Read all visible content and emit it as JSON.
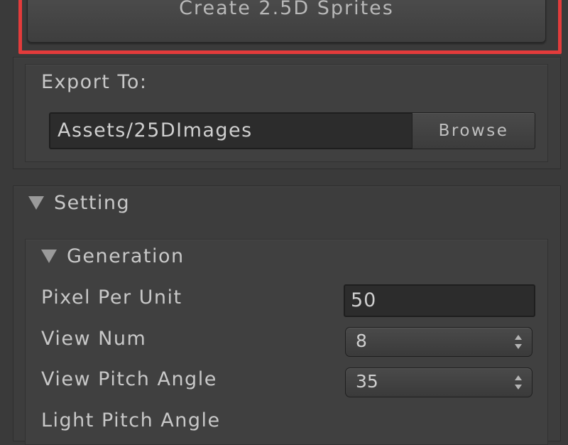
{
  "create_button": {
    "label": "Create 2.5D Sprites"
  },
  "export": {
    "label": "Export To:",
    "path_value": "Assets/25DImages",
    "browse_label": "Browse"
  },
  "setting": {
    "title": "Setting",
    "generation": {
      "title": "Generation",
      "pixel_per_unit": {
        "label": "Pixel Per Unit",
        "value": "50"
      },
      "view_num": {
        "label": "View Num",
        "value": "8"
      },
      "view_pitch_angle": {
        "label": "View Pitch Angle",
        "value": "35"
      },
      "light_pitch_angle": {
        "label": "Light Pitch Angle"
      }
    }
  },
  "colors": {
    "highlight": "#e33b3b",
    "background": "#3a3a3a",
    "field": "#2c2c2c"
  }
}
